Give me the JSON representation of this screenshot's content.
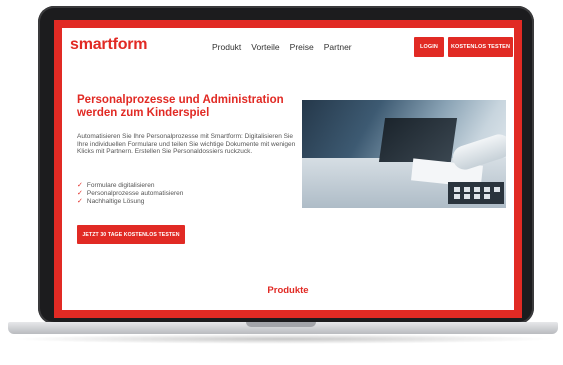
{
  "header": {
    "logo": "smartform",
    "nav": [
      "Produkt",
      "Vorteile",
      "Preise",
      "Partner"
    ],
    "login_label": "LOGIN",
    "trial_label": "KOSTENLOS TESTEN"
  },
  "hero": {
    "title": "Personalprozesse und Administration werden zum Kinderspiel",
    "body": "Automatisieren Sie Ihre Personalprozesse mit Smartform: Digitalisieren Sie Ihre individuellen Formulare und teilen Sie wichtige Dokumente mit wenigen Klicks mit Partnern. Erstellen Sie Personaldossiers ruckzuck.",
    "features": [
      "Formulare digitalisieren",
      "Personalprozesse automatisieren",
      "Nachhaltige Lösung"
    ],
    "cta_label": "JETZT 30 TAGE KOSTENLOS TESTEN",
    "check_icon": "✓"
  },
  "sections": {
    "produkte_title": "Produkte"
  },
  "colors": {
    "accent": "#e12a24",
    "bezel": "#1c1c1e"
  }
}
